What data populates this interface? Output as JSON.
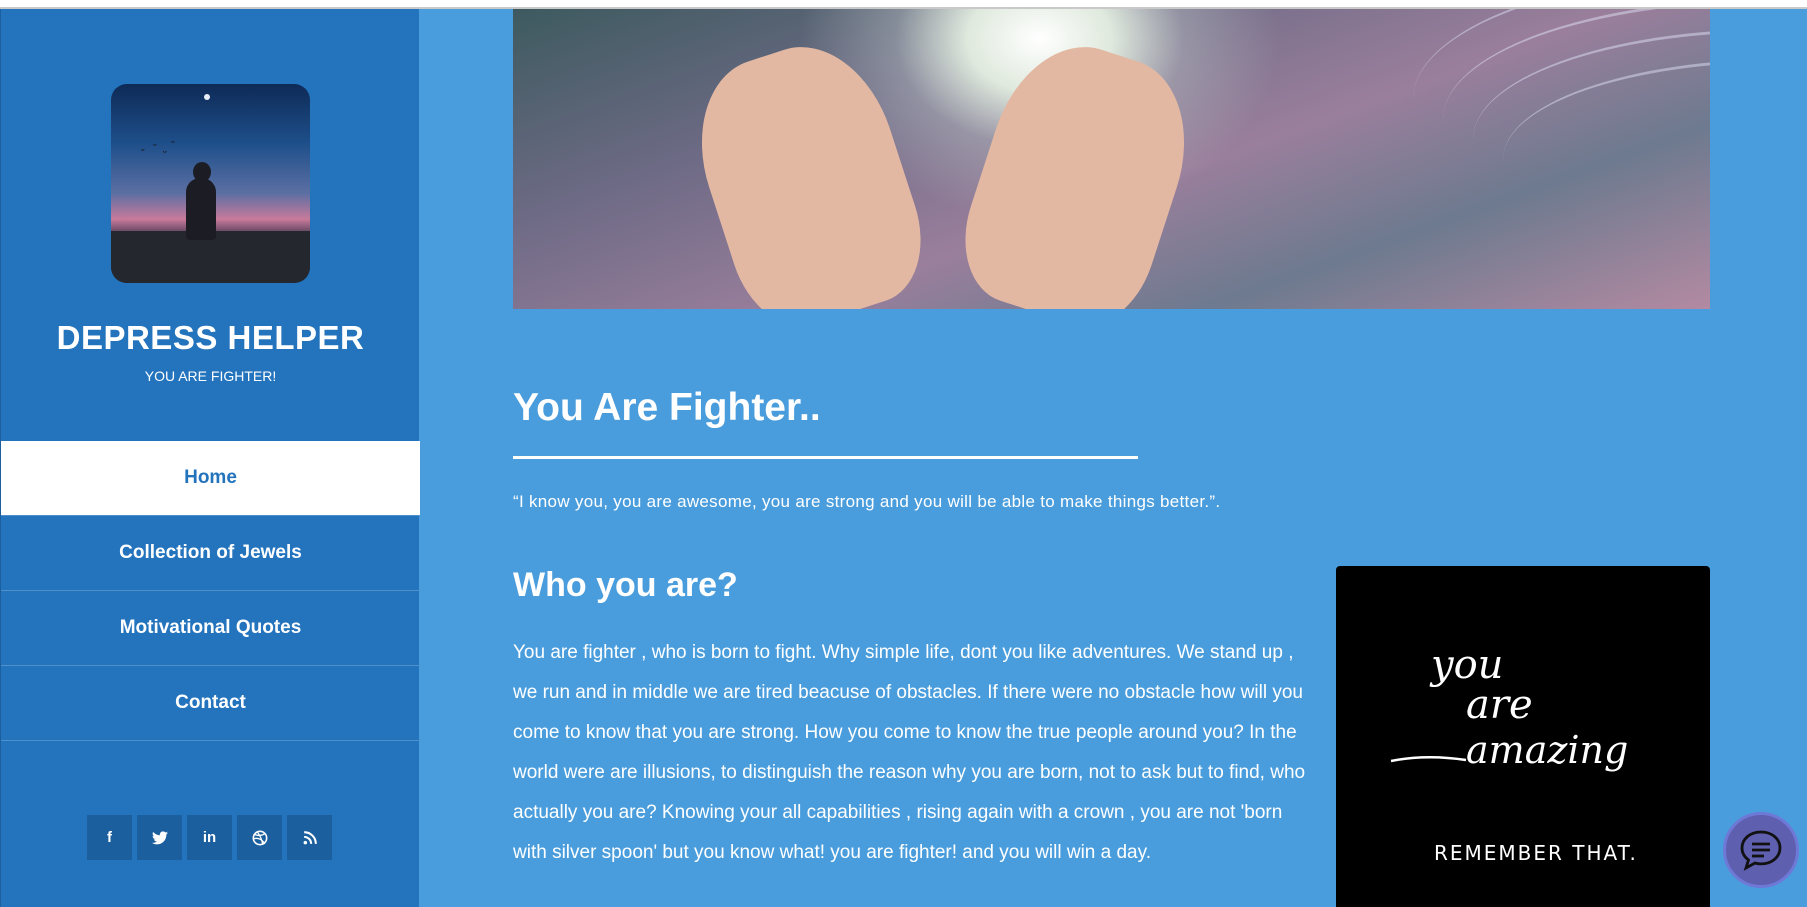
{
  "sidebar": {
    "avatar_alt": "woman silhouette at dusk",
    "site_title": "DEPRESS HELPER",
    "tagline": "YOU ARE FIGHTER!",
    "nav": [
      {
        "label": "Home",
        "active": true
      },
      {
        "label": "Collection of Jewels",
        "active": false
      },
      {
        "label": "Motivational Quotes",
        "active": false
      },
      {
        "label": "Contact",
        "active": false
      }
    ],
    "socials": [
      {
        "name": "facebook-icon",
        "glyph": "f"
      },
      {
        "name": "twitter-icon",
        "glyph": ""
      },
      {
        "name": "linkedin-icon",
        "glyph": "in"
      },
      {
        "name": "dribbble-icon",
        "glyph": ""
      },
      {
        "name": "rss-icon",
        "glyph": ""
      }
    ]
  },
  "main": {
    "hero_alt": "hands reaching toward light",
    "title": "You Are Fighter..",
    "quote": "“I know you, you are awesome, you are strong and you will be able to make things better.”.",
    "section_title": "Who you are?",
    "body": "You are fighter , who is born to fight. Why simple life, dont you like adventures. We stand up , we run and in middle we are tired beacuse of obstacles. If there were no obstacle how will you come to know that you are strong. How you come to know the true people around you? In the world were are illusions, to distinguish the reason why you are born, not to ask but to find, who actually you are? Knowing your all capabilities , rising again with a crown , you are not 'born with silver spoon' but you know what! you are fighter! and you will win a day.",
    "side_image_text": [
      "you",
      "are",
      "amazing",
      "REMEMBER THAT."
    ]
  },
  "colors": {
    "page_bg": "#4a9ddc",
    "sidebar_bg": "#2373bd",
    "social_bg": "#1b5f9e",
    "chat_bg": "#5f5fb0"
  },
  "chat": {
    "icon": "chat-bubble-icon"
  }
}
